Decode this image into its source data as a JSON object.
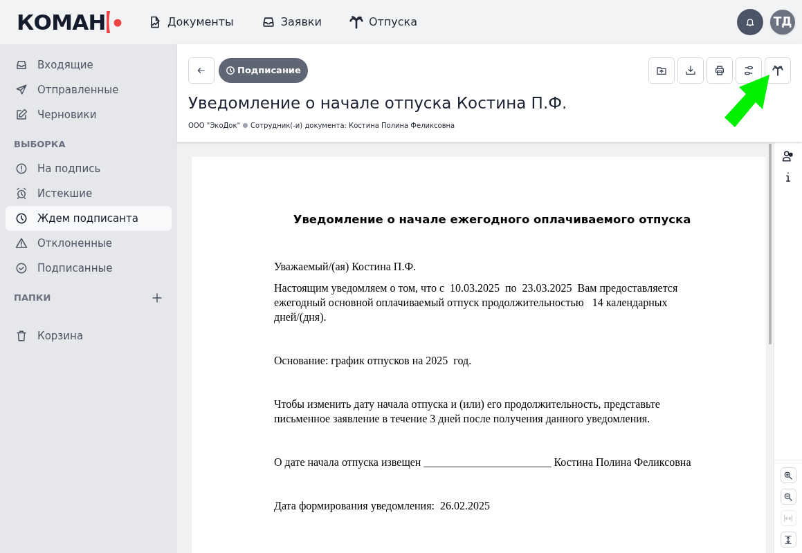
{
  "logo": {
    "text": "КОМАН"
  },
  "nav": [
    {
      "label": "Документы"
    },
    {
      "label": "Заявки"
    },
    {
      "label": "Отпуска"
    }
  ],
  "user": {
    "initials": "ТД"
  },
  "sidebar": {
    "items": [
      {
        "label": "Входящие",
        "selected": false
      },
      {
        "label": "Отправленные",
        "selected": false
      },
      {
        "label": "Черновики",
        "selected": false
      }
    ],
    "sections": [
      {
        "title": "ВЫБОРКА",
        "items": [
          {
            "label": "На подпись",
            "selected": false
          },
          {
            "label": "Истекшие",
            "selected": false
          },
          {
            "label": "Ждем подписанта",
            "selected": true
          },
          {
            "label": "Отклоненные",
            "selected": false
          },
          {
            "label": "Подписанные",
            "selected": false
          }
        ]
      },
      {
        "title": "ПАПКИ"
      }
    ],
    "bottom_items": [
      {
        "label": "Корзина",
        "selected": false
      }
    ]
  },
  "document": {
    "status": "Подписание",
    "title": "Уведомление о начале отпуска Костина П.Ф.",
    "organization": "ООО \"ЭкоДок\"",
    "employees": "Сотрудник(-и) документа: Костина Полина Феликсовна",
    "page": {
      "heading": "Уведомление о начале ежегодного оплачиваемого отпуска",
      "paragraphs": [
        "Уважаемый/(ая) Костина П.Ф.",
        "Настоящим уведомляем о том, что с  10.03.2025  по  23.03.2025  Вам предоставляется ежегодный основной оплачиваемый отпуск продолжительностью   14 календарных дней/(дня).",
        "Основание: график отпусков на 2025  год.",
        "Чтобы изменить дату начала отпуска и (или) его продолжительность, представьте письменное заявление в течение 3 дней после получения данного уведомления.",
        "О дате начала отпуска извещен _______________________ Костина Полина Феликсовна",
        "Дата формирования уведомления:  26.02.2025"
      ]
    }
  },
  "zoom_tools": [
    {
      "disabled": false
    },
    {
      "disabled": false
    },
    {
      "disabled": true
    },
    {
      "disabled": false
    }
  ]
}
